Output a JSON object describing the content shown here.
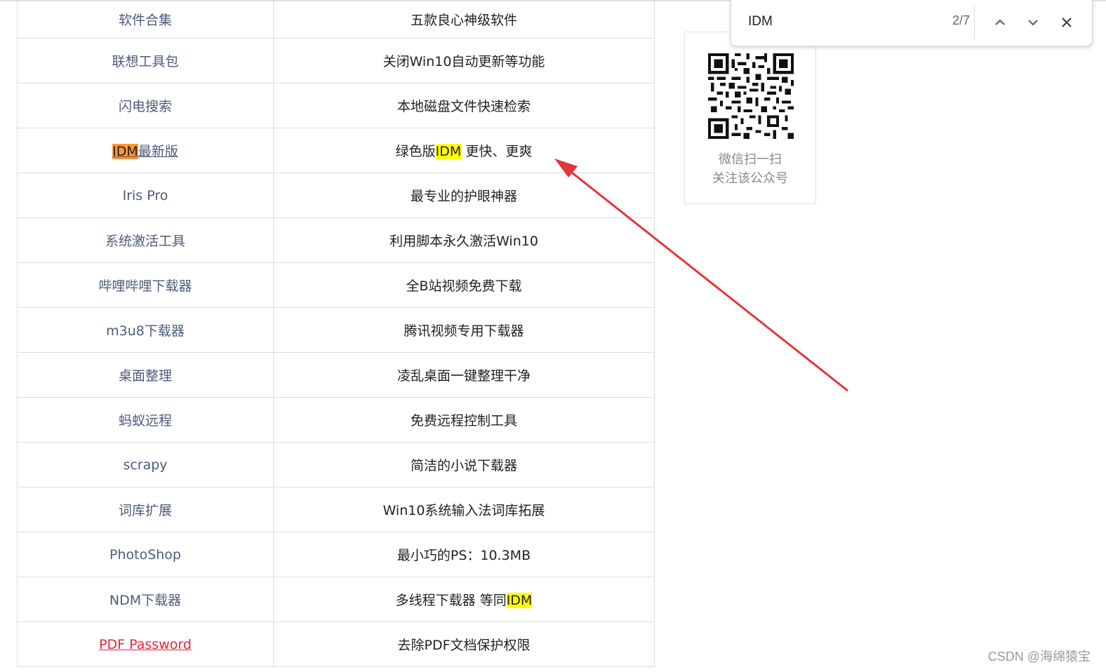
{
  "table": {
    "rows": [
      {
        "name": "软件合集",
        "desc": "五款良心神级软件"
      },
      {
        "name": "联想工具包",
        "desc": "关闭Win10自动更新等功能"
      },
      {
        "name": "闪电搜索",
        "desc": "本地磁盘文件快速检索"
      },
      {
        "name_hl": "IDM",
        "name_rest": "最新版",
        "desc_pre": "绿色版",
        "desc_hl": "IDM",
        "desc_post": " 更快、更爽"
      },
      {
        "name": "Iris Pro",
        "desc": "最专业的护眼神器"
      },
      {
        "name": "系统激活工具",
        "desc": "利用脚本永久激活Win10"
      },
      {
        "name": "哔哩哔哩下载器",
        "desc": "全B站视频免费下载"
      },
      {
        "name": "m3u8下载器",
        "desc": "腾讯视频专用下载器"
      },
      {
        "name": "桌面整理",
        "desc": "凌乱桌面一键整理干净"
      },
      {
        "name": "蚂蚁远程",
        "desc": "免费远程控制工具"
      },
      {
        "name": "scrapy",
        "desc": "简洁的小说下载器"
      },
      {
        "name": "词库扩展",
        "desc": "Win10系统输入法词库拓展"
      },
      {
        "name": "PhotoShop",
        "desc": "最小巧的PS：10.3MB"
      },
      {
        "name": "NDM下载器",
        "desc_pre": "多线程下载器 等同",
        "desc_hl": "IDM"
      },
      {
        "name": "PDF Password",
        "desc": "去除PDF文档保护权限"
      }
    ]
  },
  "qr": {
    "caption_line1": "微信扫一扫",
    "caption_line2": "关注该公众号"
  },
  "find_bar": {
    "query": "IDM",
    "count": "2/7",
    "icons": [
      "chevron-up-icon",
      "chevron-down-icon",
      "close-icon"
    ]
  },
  "colors": {
    "current_match": "#ff9632",
    "match": "#ffff00",
    "annotation_arrow": "#e8333a",
    "link_red": "#e8243b"
  },
  "watermark": "CSDN @海绵猿宝"
}
